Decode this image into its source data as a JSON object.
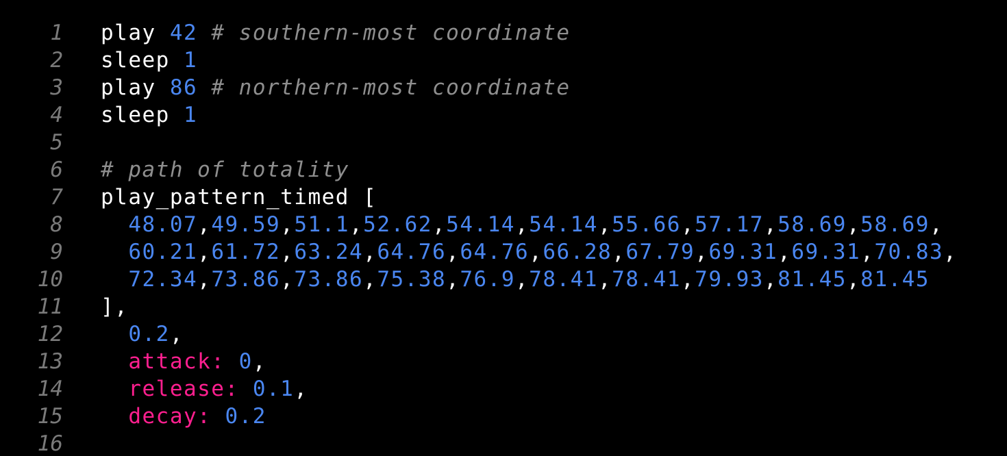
{
  "editor": {
    "lines": [
      {
        "n": "1",
        "code": "play 42 # southern-most coordinate"
      },
      {
        "n": "2",
        "code": "sleep 1"
      },
      {
        "n": "3",
        "code": "play 86 # northern-most coordinate"
      },
      {
        "n": "4",
        "code": "sleep 1"
      },
      {
        "n": "5",
        "code": ""
      },
      {
        "n": "6",
        "code": "# path of totality"
      },
      {
        "n": "7",
        "code": "play_pattern_timed ["
      },
      {
        "n": "8",
        "code": "  48.07,49.59,51.1,52.62,54.14,54.14,55.66,57.17,58.69,58.69,"
      },
      {
        "n": "9",
        "code": "  60.21,61.72,63.24,64.76,64.76,66.28,67.79,69.31,69.31,70.83,"
      },
      {
        "n": "10",
        "code": "  72.34,73.86,73.86,75.38,76.9,78.41,78.41,79.93,81.45,81.45"
      },
      {
        "n": "11",
        "code": "],"
      },
      {
        "n": "12",
        "code": "  0.2,"
      },
      {
        "n": "13",
        "code": "  attack: 0,"
      },
      {
        "n": "14",
        "code": "  release: 0.1,"
      },
      {
        "n": "15",
        "code": "  decay: 0.2"
      },
      {
        "n": "16",
        "code": ""
      }
    ]
  },
  "colors": {
    "background": "#000000",
    "text": "#ffffff",
    "number": "#4a86f0",
    "comment": "#8e8e8e",
    "keyword": "#ff1f8f",
    "line_number": "#7a7a7a"
  }
}
